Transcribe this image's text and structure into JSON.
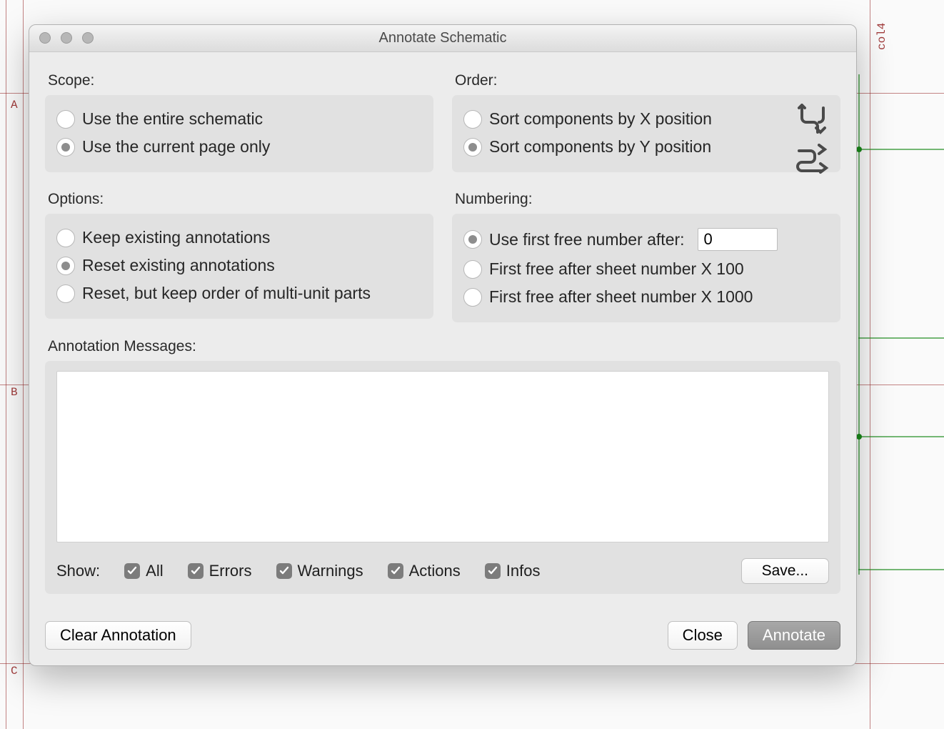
{
  "window": {
    "title": "Annotate Schematic"
  },
  "scope": {
    "label": "Scope:",
    "options": [
      {
        "label": "Use the entire schematic",
        "selected": false
      },
      {
        "label": "Use the current page only",
        "selected": true
      }
    ]
  },
  "order": {
    "label": "Order:",
    "options": [
      {
        "label": "Sort components by X position",
        "selected": false
      },
      {
        "label": "Sort components by Y position",
        "selected": true
      }
    ]
  },
  "options": {
    "label": "Options:",
    "items": [
      {
        "label": "Keep existing annotations",
        "selected": false
      },
      {
        "label": "Reset existing annotations",
        "selected": true
      },
      {
        "label": "Reset, but keep order of multi-unit parts",
        "selected": false
      }
    ]
  },
  "numbering": {
    "label": "Numbering:",
    "items": [
      {
        "label": "Use first free number after:",
        "selected": true,
        "value": "0"
      },
      {
        "label": "First free after sheet number X 100",
        "selected": false
      },
      {
        "label": "First free after sheet number X 1000",
        "selected": false
      }
    ]
  },
  "messages": {
    "label": "Annotation Messages:",
    "show_label": "Show:",
    "filters": [
      {
        "label": "All",
        "checked": true
      },
      {
        "label": "Errors",
        "checked": true
      },
      {
        "label": "Warnings",
        "checked": true
      },
      {
        "label": "Actions",
        "checked": true
      },
      {
        "label": "Infos",
        "checked": true
      }
    ],
    "save_label": "Save..."
  },
  "footer": {
    "clear_label": "Clear Annotation",
    "close_label": "Close",
    "annotate_label": "Annotate"
  },
  "bg_labels": {
    "A": "A",
    "B": "B",
    "C": "C",
    "col4": "col4"
  }
}
